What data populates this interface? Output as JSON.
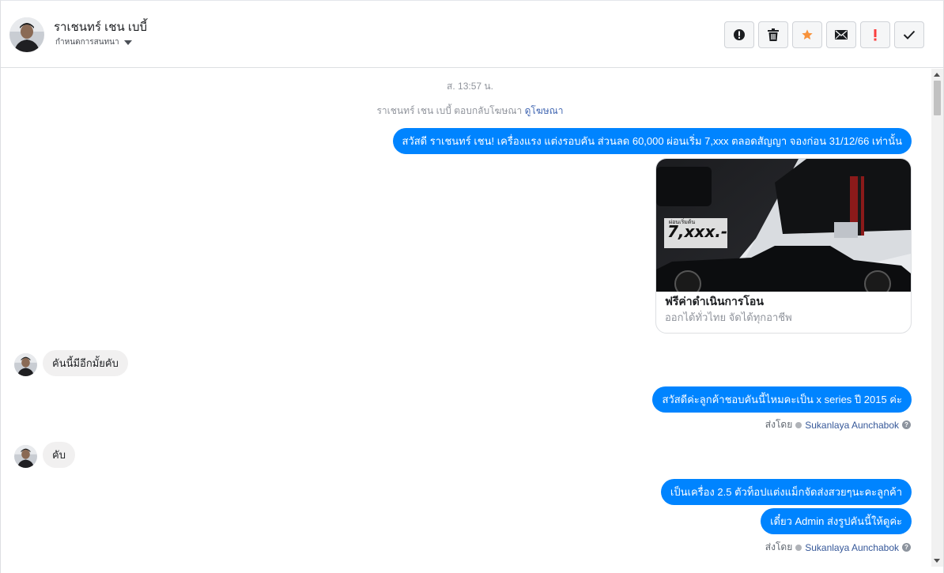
{
  "header": {
    "contact_name": "ราเชนทร์ เชน เบบี้",
    "status_label": "กำหนดการสนทนา"
  },
  "actions": [
    {
      "name": "report-spam-button",
      "icon": "alert-circle-icon"
    },
    {
      "name": "delete-button",
      "icon": "trash-icon"
    },
    {
      "name": "star-button",
      "icon": "star-icon",
      "color": "#f7923b"
    },
    {
      "name": "mark-unread-button",
      "icon": "envelope-icon"
    },
    {
      "name": "important-button",
      "icon": "exclamation-icon",
      "color": "#fa3e3e"
    },
    {
      "name": "mark-done-button",
      "icon": "check-icon"
    }
  ],
  "conversation": {
    "timestamp": "ส. 13:57 น.",
    "ad_reply_prefix": "ราเชนทร์ เชน เบบี้ ตอบกลับโฆษณา",
    "ad_reply_link": "ดูโฆษณา",
    "ad_message": "สวัสดี ราเชนทร์ เชน! เครื่องแรง แต่งรอบคัน  ส่วนลด 60,000 ผ่อนเริ่ม 7,xxx ตลอดสัญญา จองก่อน 31/12/66 เท่านั้น",
    "ad_card": {
      "image_text": "7,xxx.-",
      "image_caption": "ผ่อนเริ่มต้น",
      "title": "ฟรีค่าดำเนินการโอน",
      "subtitle": "ออกได้ทั่วไทย จัดได้ทุกอาชีพ"
    },
    "msg_in_1": "คันนี้มีอีกมั้ยคับ",
    "msg_out_1": "สวัสดีค่ะลูกค้าชอบคันนี้ไหมคะเป็น x series ปี 2015 ค่ะ",
    "sent_by_label": "ส่งโดย",
    "agent_name": "Sukanlaya Aunchabok",
    "msg_in_2": "คับ",
    "msg_out_2": "เป็นเครื่อง 2.5 ตัวท็อปแต่งแม็กจัดส่งสวยๆนะคะลูกค้า",
    "msg_out_3": "เดี๋ยว Admin ส่งรูปคันนี้ให้ดูค่ะ"
  },
  "colors": {
    "accent": "#0084ff",
    "link": "#4267b2",
    "incoming_bubble": "#f1f0f0"
  }
}
